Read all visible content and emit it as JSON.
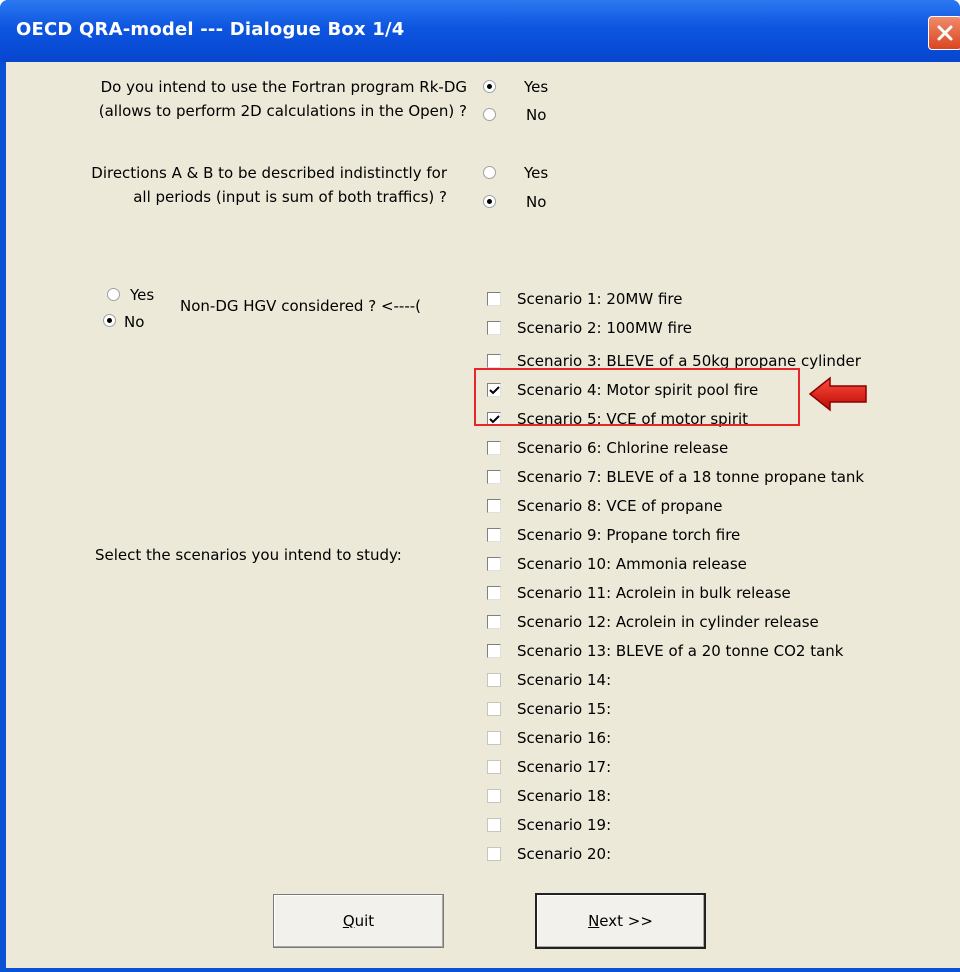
{
  "window": {
    "title": "OECD QRA-model --- Dialogue Box 1/4",
    "close_icon": "close-icon"
  },
  "q1": {
    "line1": "Do you intend to use the Fortran program Rk-DG",
    "line2": "(allows to perform 2D calculations in the Open) ?",
    "options": [
      "Yes",
      "No"
    ],
    "selected": "Yes"
  },
  "q2": {
    "line1": "Directions A & B to be described indistinctly for",
    "line2": "all periods (input is sum of both traffics) ?",
    "options": [
      "Yes",
      "No"
    ],
    "selected": "No"
  },
  "hgv": {
    "label": "Non-DG HGV considered ? <----(",
    "options": [
      "Yes",
      "No"
    ],
    "selected": "No"
  },
  "scenarios_prompt": "Select the scenarios you intend to study:",
  "scenarios": [
    {
      "label": "Scenario 1: 20MW fire",
      "checked": false,
      "enabled": true
    },
    {
      "label": "Scenario 2: 100MW fire",
      "checked": false,
      "enabled": true
    },
    {
      "label": "Scenario 3: BLEVE of a 50kg propane cylinder",
      "checked": false,
      "enabled": true
    },
    {
      "label": "Scenario 4: Motor spirit pool fire",
      "checked": true,
      "enabled": true
    },
    {
      "label": "Scenario 5: VCE of motor spirit",
      "checked": true,
      "enabled": true
    },
    {
      "label": "Scenario 6: Chlorine release",
      "checked": false,
      "enabled": true
    },
    {
      "label": "Scenario 7: BLEVE of a 18 tonne propane tank",
      "checked": false,
      "enabled": true
    },
    {
      "label": "Scenario 8: VCE of propane",
      "checked": false,
      "enabled": true
    },
    {
      "label": "Scenario 9: Propane torch fire",
      "checked": false,
      "enabled": true
    },
    {
      "label": "Scenario 10: Ammonia release",
      "checked": false,
      "enabled": true
    },
    {
      "label": "Scenario 11: Acrolein in bulk release",
      "checked": false,
      "enabled": true
    },
    {
      "label": "Scenario 12: Acrolein in cylinder release",
      "checked": false,
      "enabled": true
    },
    {
      "label": "Scenario 13: BLEVE of a 20 tonne CO2 tank",
      "checked": false,
      "enabled": true
    },
    {
      "label": "Scenario 14:",
      "checked": false,
      "enabled": false
    },
    {
      "label": "Scenario 15:",
      "checked": false,
      "enabled": false
    },
    {
      "label": "Scenario 16:",
      "checked": false,
      "enabled": false
    },
    {
      "label": "Scenario 17:",
      "checked": false,
      "enabled": false
    },
    {
      "label": "Scenario 18:",
      "checked": false,
      "enabled": false
    },
    {
      "label": "Scenario 19:",
      "checked": false,
      "enabled": false
    },
    {
      "label": "Scenario 20:",
      "checked": false,
      "enabled": false
    }
  ],
  "buttons": {
    "quit": {
      "accel": "Q",
      "rest": "uit"
    },
    "next": {
      "accel": "N",
      "rest": "ext >>"
    }
  },
  "colors": {
    "titlebar": "#0a51d6",
    "highlight": "#e8262a",
    "dialog_bg": "#ece9d8"
  }
}
